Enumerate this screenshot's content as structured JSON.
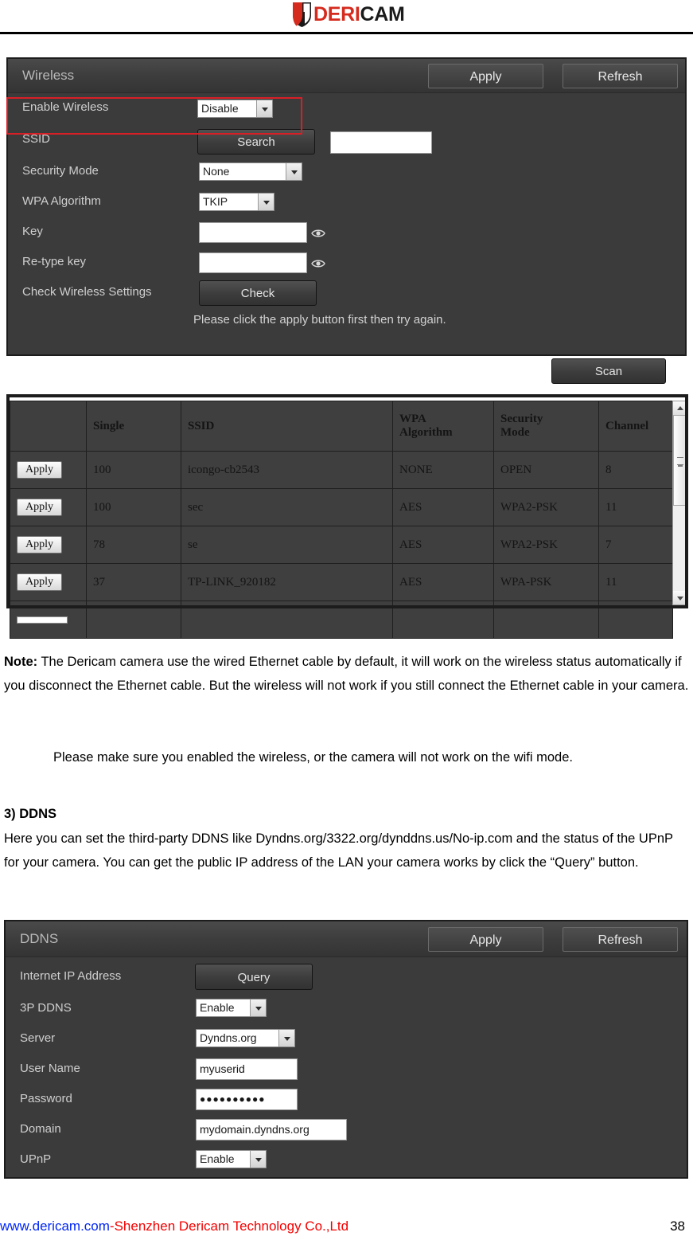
{
  "brand": {
    "logo_deri": "DERI",
    "logo_cam": "CAM",
    "shield_icon": "shield-icon",
    "red": "#d52b1e",
    "black": "#1a1a1a"
  },
  "wireless_panel": {
    "title": "Wireless",
    "apply_label": "Apply",
    "refresh_label": "Refresh",
    "highlight_color": "#d81f26",
    "rows": {
      "enable_wireless_label": "Enable Wireless",
      "enable_wireless_value": "Disable",
      "ssid_label": "SSID",
      "ssid_search_label": "Search",
      "ssid_value": "",
      "security_mode_label": "Security Mode",
      "security_mode_value": "None",
      "wpa_algorithm_label": "WPA Algorithm",
      "wpa_algorithm_value": "TKIP",
      "key_label": "Key",
      "key_value": "",
      "retype_key_label": "Re-type key",
      "retype_key_value": "",
      "check_settings_label": "Check Wireless Settings",
      "check_button_label": "Check"
    },
    "hint": "Please click the apply button first then try again.",
    "scan_label": "Scan"
  },
  "scan_table": {
    "columns": [
      "",
      "Single",
      "SSID",
      "WPA Algorithm",
      "Security Mode",
      "Channel"
    ],
    "rows": [
      {
        "apply": "Apply",
        "single": "100",
        "ssid": "icongo-cb2543",
        "wpa": "NONE",
        "security": "OPEN",
        "channel": "8"
      },
      {
        "apply": "Apply",
        "single": "100",
        "ssid": "sec",
        "wpa": "AES",
        "security": "WPA2-PSK",
        "channel": "11"
      },
      {
        "apply": "Apply",
        "single": "78",
        "ssid": "se",
        "wpa": "AES",
        "security": "WPA2-PSK",
        "channel": "7"
      },
      {
        "apply": "Apply",
        "single": "37",
        "ssid": "TP-LINK_920182",
        "wpa": "AES",
        "security": "WPA-PSK",
        "channel": "11"
      }
    ]
  },
  "body": {
    "note_bold": "Note:",
    "note_text": " The Dericam camera use the wired Ethernet cable by default, it will work on the wireless status automatically if you disconnect the Ethernet cable. But the wireless will not work if you still connect the Ethernet cable in your camera.",
    "note_second": "Please make sure you enabled the wireless, or the camera will not work on the wifi mode.",
    "section_heading": "3) DDNS",
    "section_text": "Here you can set the third-party DDNS like Dyndns.org/3322.org/dynddns.us/No-ip.com and the status of the UPnP for your camera. You can get the public IP address of the LAN your camera works by click the “Query” button."
  },
  "ddns_panel": {
    "title": "DDNS",
    "apply_label": "Apply",
    "refresh_label": "Refresh",
    "rows": {
      "internet_ip_label": "Internet IP Address",
      "query_button_label": "Query",
      "third_party_ddns_label": "3P DDNS",
      "third_party_ddns_value": "Enable",
      "server_label": "Server",
      "server_value": "Dyndns.org",
      "user_name_label": "User Name",
      "user_name_value": "myuserid",
      "password_label": "Password",
      "password_value": "●●●●●●●●●●",
      "domain_label": "Domain",
      "domain_value": "mydomain.dyndns.org",
      "upnp_label": "UPnP",
      "upnp_value": "Enable"
    }
  },
  "footer": {
    "website": "www.dericam.com",
    "company": "-Shenzhen Dericam Technology Co.,Ltd",
    "page_number": "38"
  }
}
